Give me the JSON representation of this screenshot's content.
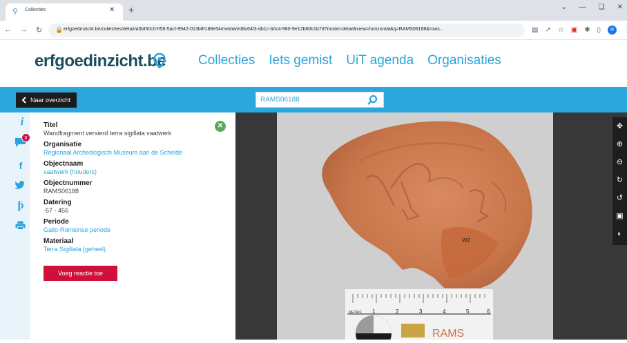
{
  "browser": {
    "tab_title": "Collecties",
    "url": "erfgoedinzicht.be/collecties/detail/a0bf30c0-ff56-5acf-9942-013b8f188e54/media/ed8c64f3-db1c-b0c4-ff60-9e12b60b1b7d?mode=detail&view=horizontal&q=RAMS06188&rows...",
    "profile_initial": "R"
  },
  "site": {
    "logo_text": "erfgoedinzicht",
    "logo_tld": ".be",
    "nav": [
      "Collecties",
      "Iets gemist",
      "UiT agenda",
      "Organisaties"
    ],
    "brand_color": "#2ca7dd"
  },
  "toolbar": {
    "back_label": "Naar overzicht",
    "search_value": "RAMS06188"
  },
  "side": {
    "comment_count": "0",
    "icons": [
      "info-icon",
      "comment-icon",
      "facebook-icon",
      "twitter-icon",
      "pinterest-icon",
      "print-icon"
    ]
  },
  "record": {
    "fields": [
      {
        "label": "Titel",
        "value": "Wandfragment versierd terra sigillata vaatwerk",
        "link": false
      },
      {
        "label": "Organisatie",
        "value": "Regionaal Archeologisch Museum aan de Schelde",
        "link": true
      },
      {
        "label": "Objectnaam",
        "value": "vaatwerk (houders)",
        "link": true
      },
      {
        "label": "Objectnummer",
        "value": "RAMS06188",
        "link": false
      },
      {
        "label": "Datering",
        "value": "-57 - 456",
        "link": false
      },
      {
        "label": "Periode",
        "value": "Gallo-Romeinse periode",
        "link": true
      },
      {
        "label": "Materiaal",
        "value": "Terra Sigillata (geheel)",
        "link": true
      }
    ],
    "comment_button": "Voeg reactie toe"
  },
  "viewer": {
    "scale_label": "METRIC",
    "scale_numbers": [
      "1",
      "2",
      "3",
      "4",
      "5",
      "6"
    ],
    "sherd_mark": "W2",
    "label_text": "RAMS",
    "tools": [
      "pan-icon",
      "zoom-in-icon",
      "zoom-out-icon",
      "rotate-right-icon",
      "rotate-left-icon",
      "fullscreen-icon",
      "navigator-icon"
    ]
  }
}
